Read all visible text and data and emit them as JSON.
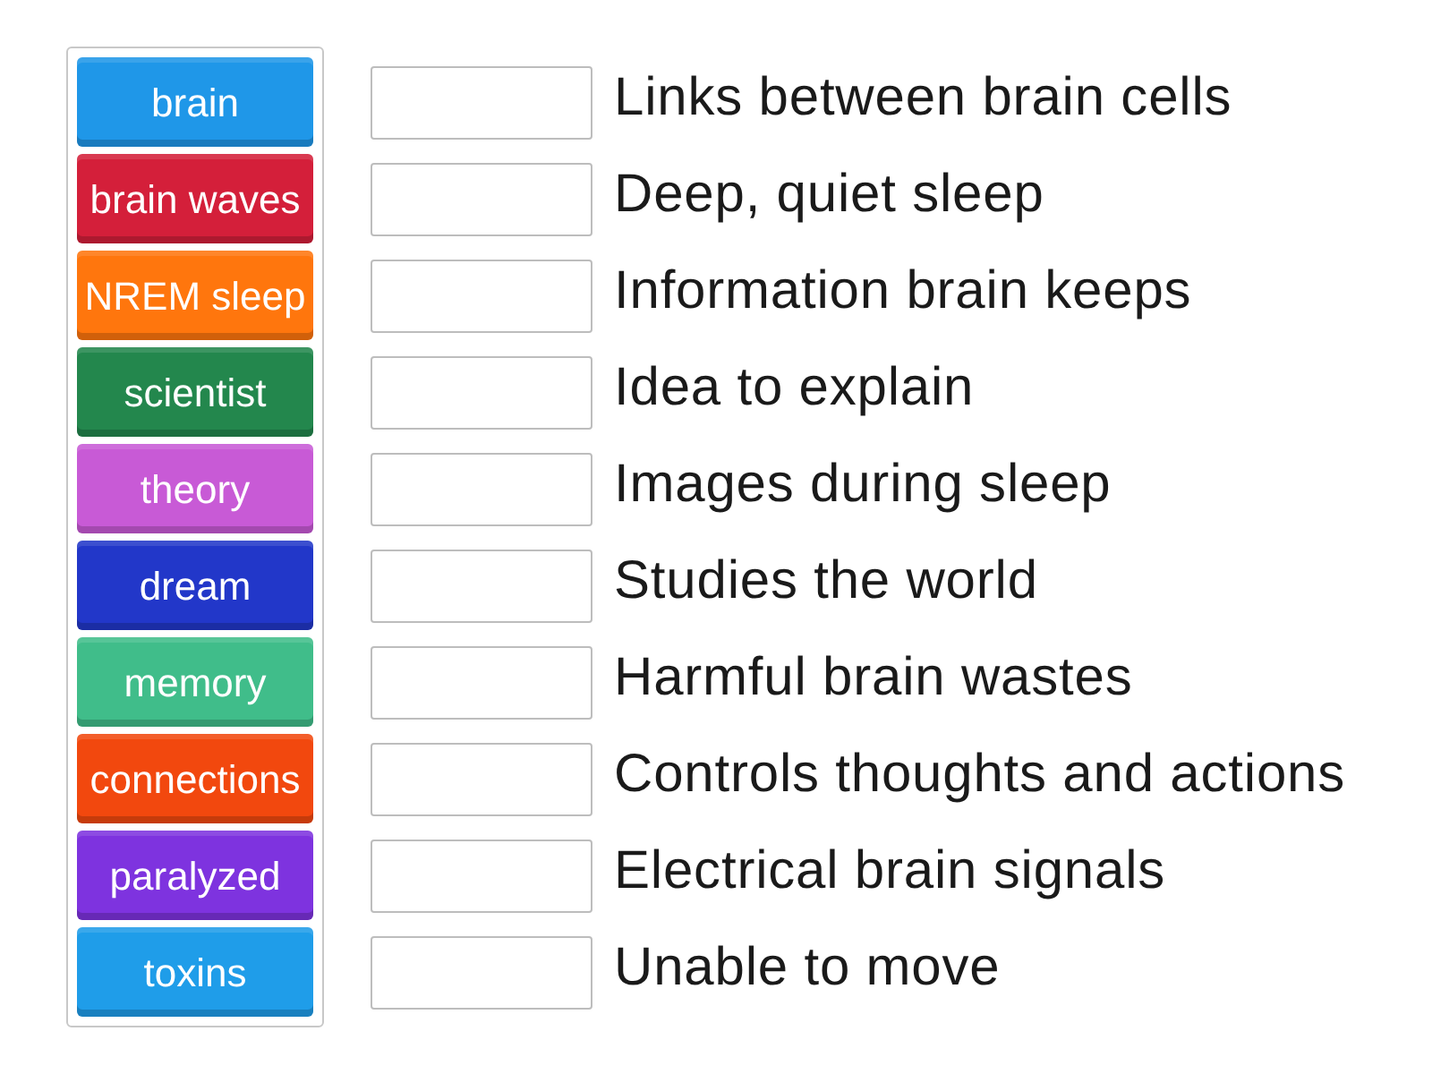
{
  "tiles": [
    {
      "label": "brain",
      "color": "#1f97e8"
    },
    {
      "label": "brain waves",
      "color": "#d41f3a"
    },
    {
      "label": "NREM sleep",
      "color": "#ff760d"
    },
    {
      "label": "scientist",
      "color": "#23874d"
    },
    {
      "label": "theory",
      "color": "#c85ad6"
    },
    {
      "label": "dream",
      "color": "#2237c9"
    },
    {
      "label": "memory",
      "color": "#40bd8a"
    },
    {
      "label": "connections",
      "color": "#f2480e"
    },
    {
      "label": "paralyzed",
      "color": "#7e33df"
    },
    {
      "label": "toxins",
      "color": "#1f9de9"
    }
  ],
  "rows": [
    {
      "clue": "Links between brain cells"
    },
    {
      "clue": "Deep, quiet sleep"
    },
    {
      "clue": "Information brain keeps"
    },
    {
      "clue": "Idea to explain"
    },
    {
      "clue": "Images during sleep"
    },
    {
      "clue": "Studies the world"
    },
    {
      "clue": "Harmful brain wastes"
    },
    {
      "clue": "Controls thoughts and actions"
    },
    {
      "clue": "Electrical brain signals"
    },
    {
      "clue": "Unable to move"
    }
  ]
}
